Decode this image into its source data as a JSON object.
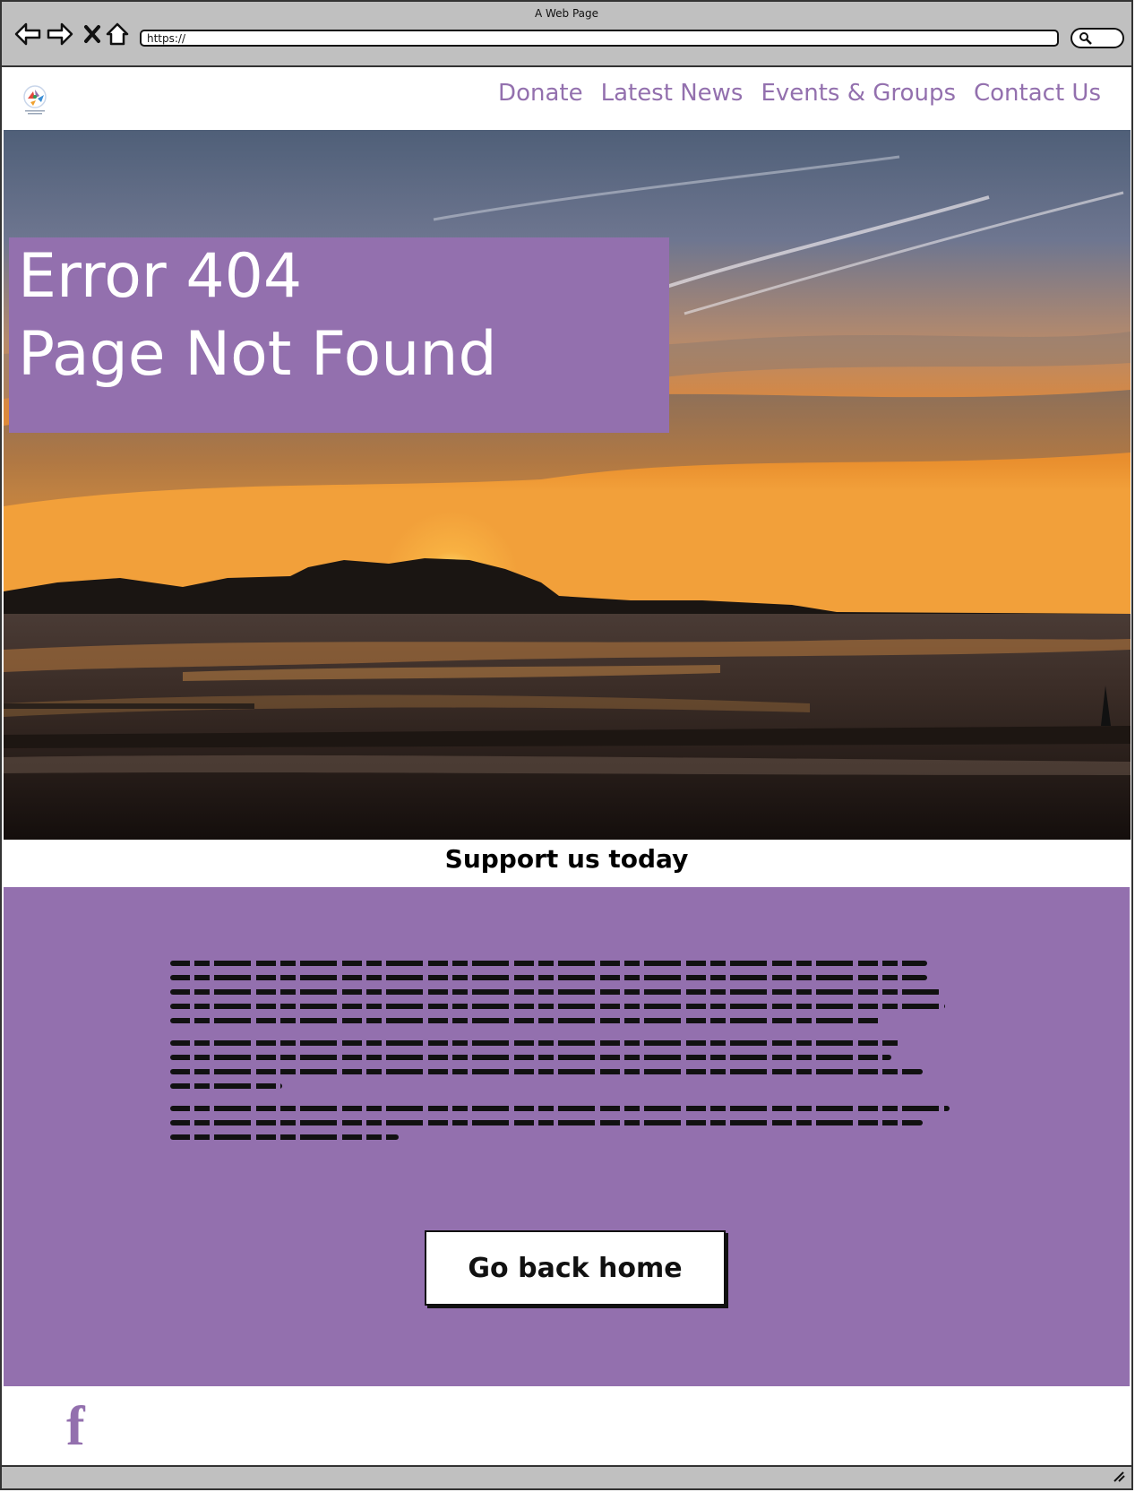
{
  "browser": {
    "title": "A Web Page",
    "url": "https://",
    "back_icon": "back-arrow-icon",
    "forward_icon": "forward-arrow-icon",
    "close_icon": "close-icon",
    "home_icon": "home-icon",
    "search_icon": "search-icon"
  },
  "header": {
    "logo": "logo",
    "nav": [
      "Donate",
      "Latest News",
      "Events & Groups",
      "Contact Us"
    ]
  },
  "hero": {
    "line1": "Error 404",
    "line2": "Page Not Found"
  },
  "support": {
    "title": "Support us today",
    "button": "Go back home"
  },
  "footer": {
    "social_icon": "facebook-icon",
    "social_glyph": "f"
  },
  "colors": {
    "accent": "#9370ae",
    "chrome": "#c0c0c0"
  }
}
